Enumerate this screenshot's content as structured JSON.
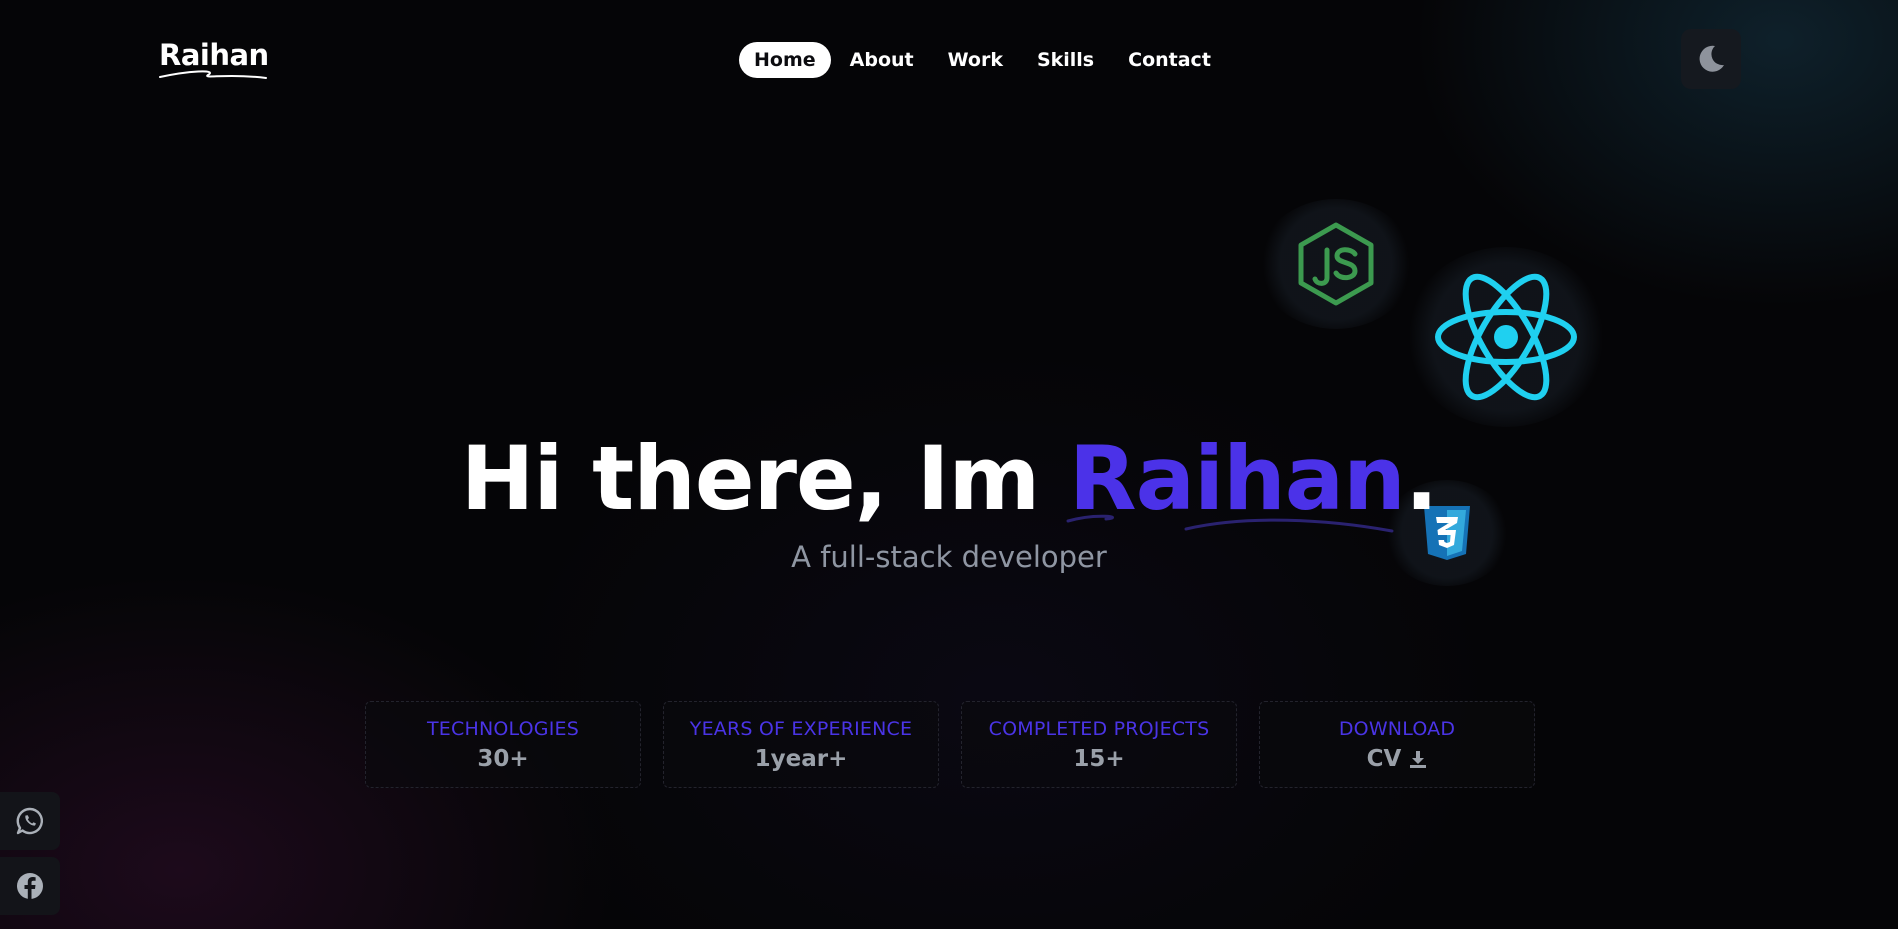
{
  "header": {
    "logo_text": "Raihan",
    "nav": [
      {
        "label": "Home",
        "active": true
      },
      {
        "label": "About",
        "active": false
      },
      {
        "label": "Work",
        "active": false
      },
      {
        "label": "Skills",
        "active": false
      },
      {
        "label": "Contact",
        "active": false
      }
    ],
    "theme_toggle_icon": "moon-icon"
  },
  "hero": {
    "greeting": "Hi there, Im ",
    "name": "Raihan",
    "punctuation": ".",
    "subtitle": "A full-stack developer",
    "floating_icons": [
      "nodejs-icon",
      "react-icon",
      "css3-icon"
    ]
  },
  "stats": [
    {
      "label": "TECHNOLOGIES",
      "value": "30+"
    },
    {
      "label": "YEARS OF EXPERIENCE",
      "value": "1year+"
    },
    {
      "label": "COMPLETED PROJECTS",
      "value": "15+"
    },
    {
      "label": "DOWNLOAD",
      "value": "CV",
      "icon": "download-icon"
    }
  ],
  "social": [
    "whatsapp-icon",
    "facebook-icon"
  ],
  "colors": {
    "accent": "#4b32e8",
    "background": "#050507",
    "muted_text": "#8f96a3",
    "nodejs_green": "#3c9a4f",
    "react_cyan": "#1fd0f0",
    "css_blue": "#1572b6"
  }
}
